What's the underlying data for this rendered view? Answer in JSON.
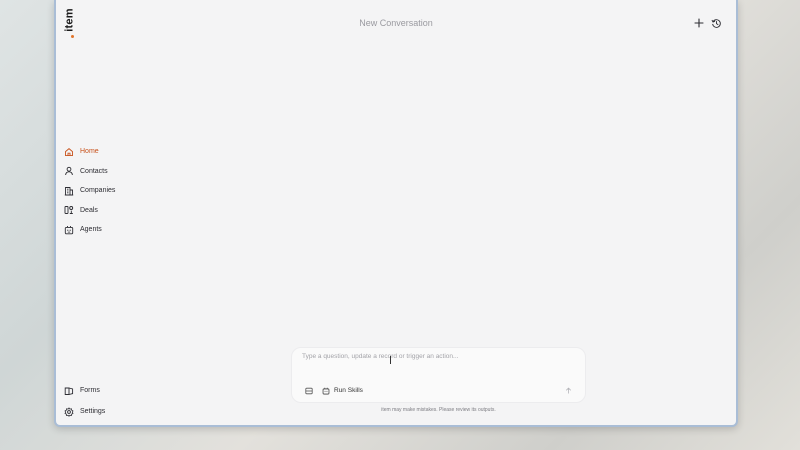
{
  "app": {
    "logo_text": "item",
    "accent": "#c8521c",
    "logo_dot_color": "#e2742b"
  },
  "header": {
    "title": "New Conversation",
    "new_icon": "plus-icon",
    "history_icon": "history-icon"
  },
  "sidebar": {
    "items": [
      {
        "label": "Home",
        "icon": "home-icon",
        "active": true
      },
      {
        "label": "Contacts",
        "icon": "user-icon",
        "active": false
      },
      {
        "label": "Companies",
        "icon": "building-icon",
        "active": false
      },
      {
        "label": "Deals",
        "icon": "deals-icon",
        "active": false
      },
      {
        "label": "Agents",
        "icon": "robot-icon",
        "active": false
      }
    ],
    "bottom_items": [
      {
        "label": "Forms",
        "icon": "forms-icon"
      },
      {
        "label": "Settings",
        "icon": "gear-icon"
      }
    ]
  },
  "composer": {
    "placeholder": "Type a question, update a record or trigger an action...",
    "value": "",
    "run_skills_label": "Run Skills",
    "attach_icon": "attach-icon",
    "send_icon": "arrow-up-icon"
  },
  "footer": {
    "disclaimer": "item may make mistakes. Please review its outputs."
  }
}
